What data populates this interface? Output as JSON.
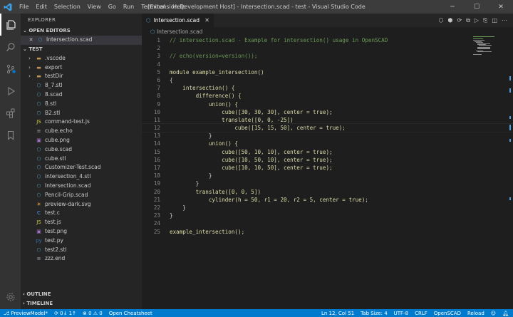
{
  "titlebar": {
    "menu": [
      "File",
      "Edit",
      "Selection",
      "View",
      "Go",
      "Run",
      "Terminal",
      "Help"
    ],
    "title": "[Extension Development Host] - Intersection.scad - test - Visual Studio Code"
  },
  "sidebar": {
    "title": "EXPLORER",
    "open_editors_label": "OPEN EDITORS",
    "open_editors": [
      {
        "name": "Intersection.scad"
      }
    ],
    "workspace_label": "TEST",
    "folders": [
      ".vscode",
      "export",
      "testDir"
    ],
    "files": [
      "8_7.stl",
      "8.scad",
      "8.stl",
      "B2.stl",
      "command-test.js",
      "cube.echo",
      "cube.png",
      "cube.scad",
      "cube.stl",
      "Customizer-Test.scad",
      "intersection_4.stl",
      "Intersection.scad",
      "Pencil-Grip.scad",
      "preview-dark.svg",
      "test.c",
      "test.js",
      "test.png",
      "test.py",
      "test2.stl",
      "zzz.end"
    ],
    "outline_label": "OUTLINE",
    "timeline_label": "TIMELINE"
  },
  "editor": {
    "tab_label": "Intersection.scad",
    "breadcrumb": "Intersection.scad",
    "lines": [
      "// intersection.scad - Example for intersection() usage in OpenSCAD",
      "",
      "// echo(version=version());",
      "",
      "module example_intersection()",
      "{",
      "    intersection() {",
      "        difference() {",
      "            union() {",
      "                cube([30, 30, 30], center = true);",
      "                translate([0, 0, -25])",
      "                    cube([15, 15, 50], center = true);",
      "            }",
      "            union() {",
      "                cube([50, 10, 10], center = true);",
      "                cube([10, 50, 10], center = true);",
      "                cube([10, 10, 50], center = true);",
      "            }",
      "        }",
      "        translate([0, 0, 5])",
      "            cylinder(h = 50, r1 = 20, r2 = 5, center = true);",
      "    }",
      "}",
      "",
      "example_intersection();"
    ]
  },
  "statusbar": {
    "branch": "PreviewModel*",
    "sync": "0↓ 1↑",
    "problems": "⊗ 0 ⚠ 0",
    "cheatsheet": "Open Cheatsheet",
    "position": "Ln 12, Col 51",
    "tab_size": "Tab Size: 4",
    "encoding": "UTF-8",
    "eol": "CRLF",
    "language": "OpenSCAD",
    "reload": "Reload"
  },
  "colors": {
    "titlebar": "#3c3c3c",
    "activitybar": "#333333",
    "sidebar": "#252526",
    "editor": "#1e1e1e",
    "statusbar": "#007acc"
  }
}
